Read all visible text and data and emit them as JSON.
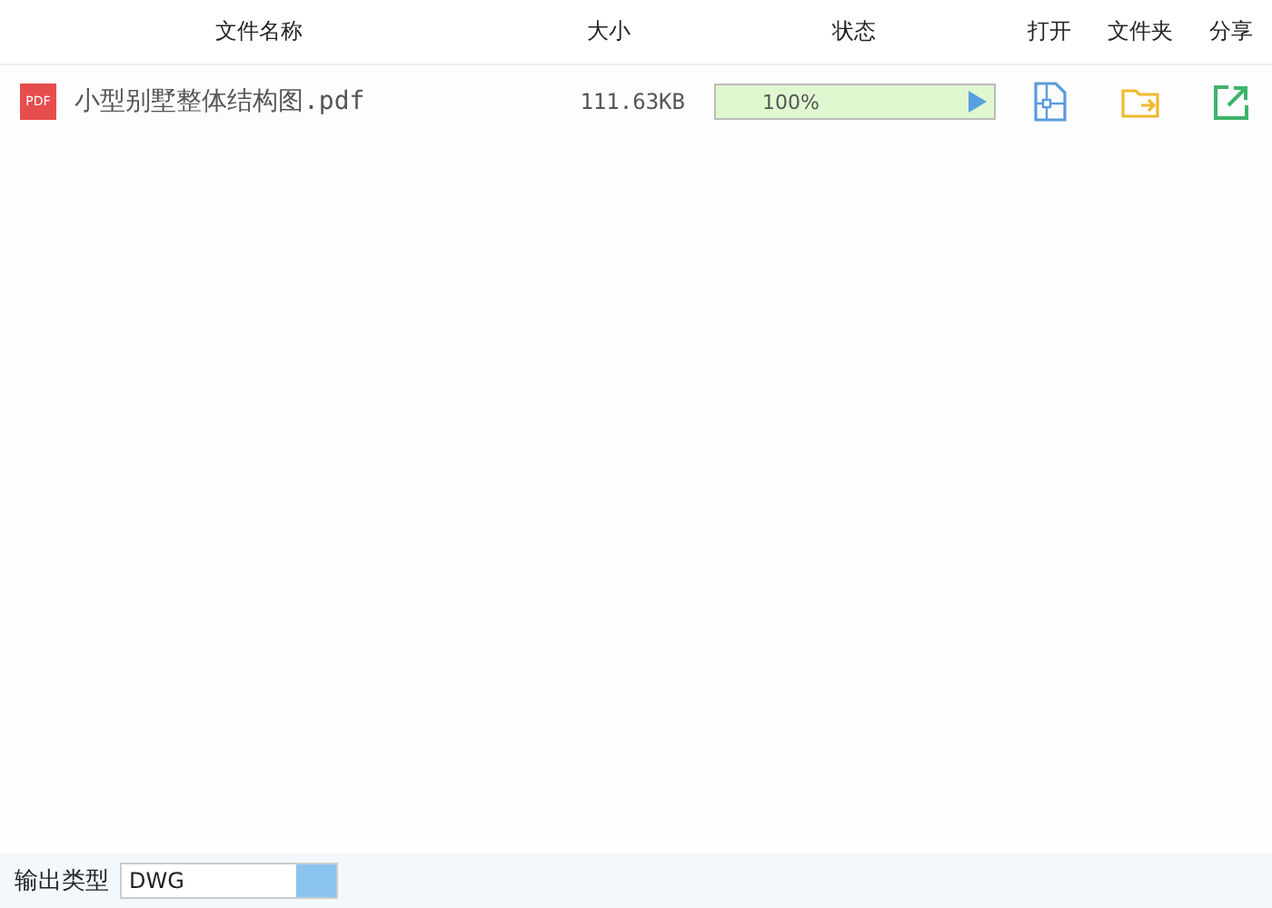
{
  "table": {
    "columns": [
      "文件名称",
      "大小",
      "状态",
      "打开",
      "文件夹",
      "分享"
    ],
    "rows": [
      {
        "file_type": "PDF",
        "name": "小型别墅整体结构图.pdf",
        "size": "111.63KB",
        "progress": {
          "level": 1.0,
          "reading": "100%"
        }
      }
    ]
  },
  "bottom_bar": {
    "label": "输出类型",
    "dropdown": {
      "value": "DWG"
    }
  }
}
